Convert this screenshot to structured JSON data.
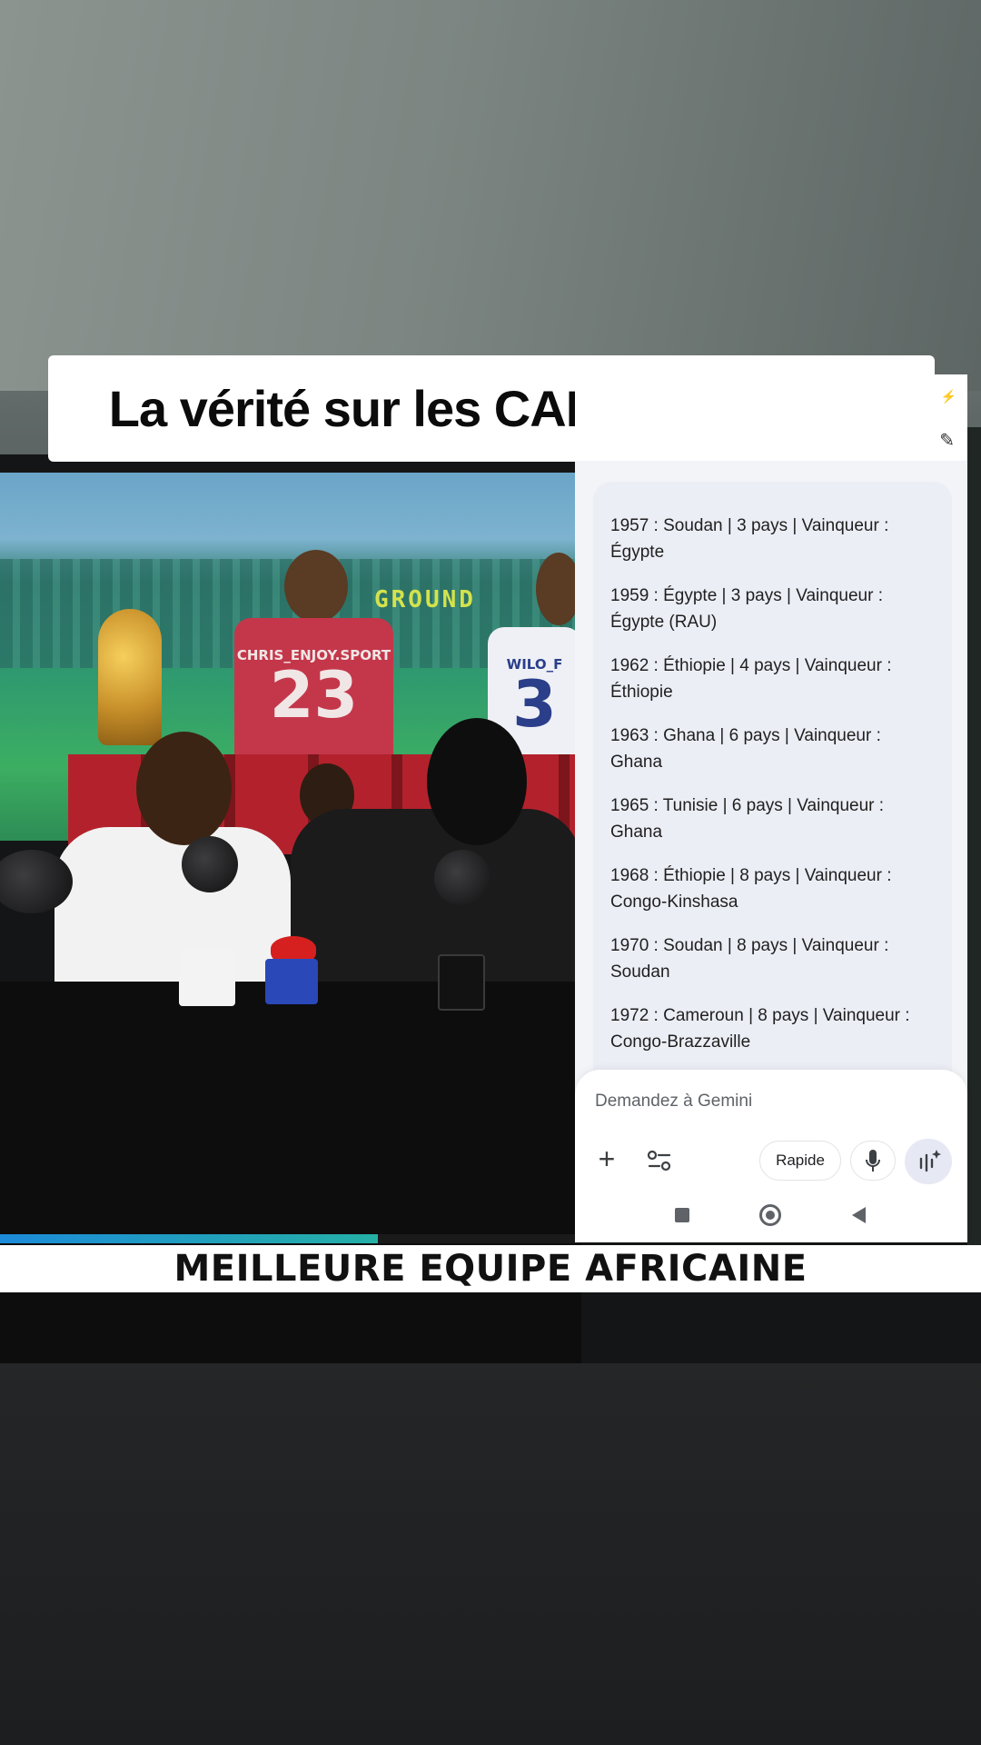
{
  "title_card": {
    "text": "La vérité sur les CAN de l'Égypte"
  },
  "caption": {
    "text": "MEILLEURE EQUIPE AFRICAINE"
  },
  "video": {
    "mural_logo": "GROUND",
    "jersey_red": {
      "name": "CHRIS_ENJOY.SPORT",
      "number": "23"
    },
    "jersey_white": {
      "name": "WILO_F",
      "number": "3"
    },
    "progress_fraction": 0.65,
    "accent_colors": [
      "#1c8bd9",
      "#25b0a6"
    ]
  },
  "gemini": {
    "entries": [
      {
        "line1": "1957 : Soudan | 3 pays | Vainqueur :",
        "line2": "Égypte"
      },
      {
        "line1": "1959 : Égypte | 3 pays | Vainqueur :",
        "line2": "Égypte (RAU)"
      },
      {
        "line1": "1962 : Éthiopie | 4 pays | Vainqueur :",
        "line2": "Éthiopie"
      },
      {
        "line1": "1963 : Ghana | 6 pays | Vainqueur :",
        "line2": "Ghana"
      },
      {
        "line1": "1965 : Tunisie | 6 pays | Vainqueur :",
        "line2": "Ghana"
      },
      {
        "line1": "1968 : Éthiopie | 8 pays | Vainqueur :",
        "line2": "Congo-Kinshasa"
      },
      {
        "line1": "1970 : Soudan | 8 pays | Vainqueur :",
        "line2": "Soudan"
      },
      {
        "line1": "1972 : Cameroun | 8 pays | Vainqueur :",
        "line2": "Congo-Brazzaville"
      }
    ],
    "composer": {
      "placeholder": "Demandez à Gemini",
      "mode_label": "Rapide"
    },
    "icons": {
      "plus": "plus-icon",
      "tools": "tools-icon",
      "mic": "microphone-icon",
      "live": "live-sparkle-icon",
      "edit": "edit-icon",
      "flash": "flash-icon"
    }
  }
}
